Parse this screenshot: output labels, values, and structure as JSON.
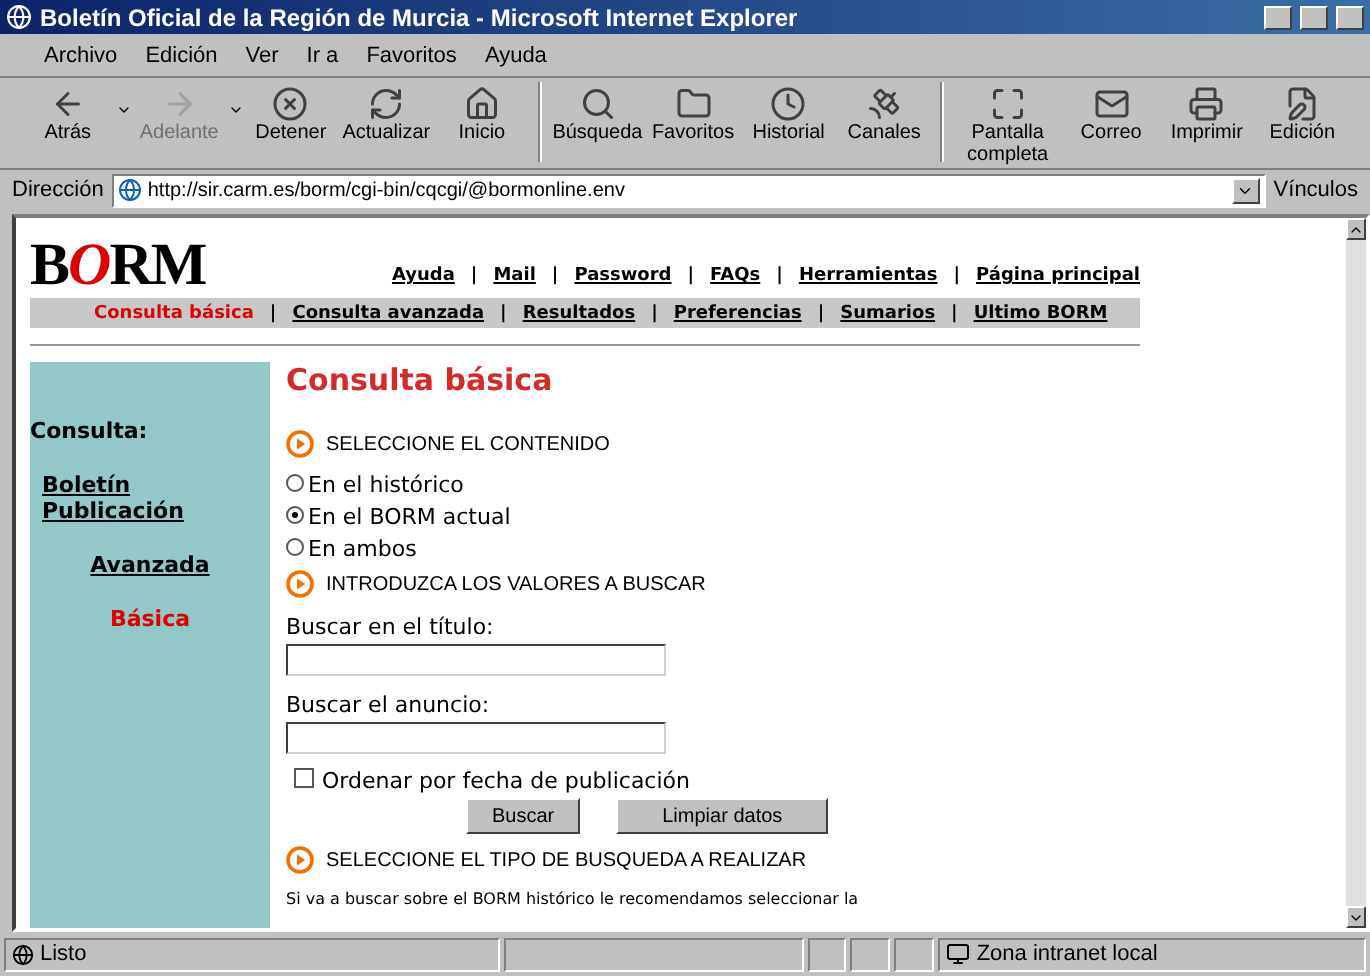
{
  "window": {
    "title": "Boletín Oficial de la Región de Murcia - Microsoft Internet Explorer"
  },
  "menu": [
    "Archivo",
    "Edición",
    "Ver",
    "Ir a",
    "Favoritos",
    "Ayuda"
  ],
  "toolbar": [
    {
      "kind": "back",
      "label": "Atrás",
      "disabled": false,
      "dropdown": true
    },
    {
      "kind": "forward",
      "label": "Adelante",
      "disabled": true,
      "dropdown": true
    },
    {
      "kind": "stop",
      "label": "Detener",
      "disabled": false,
      "dropdown": false
    },
    {
      "kind": "refresh",
      "label": "Actualizar",
      "disabled": false,
      "dropdown": false
    },
    {
      "kind": "home",
      "label": "Inicio",
      "disabled": false,
      "dropdown": false,
      "group_end": true
    },
    {
      "kind": "search",
      "label": "Búsqueda",
      "disabled": false,
      "dropdown": false
    },
    {
      "kind": "favorites",
      "label": "Favoritos",
      "disabled": false,
      "dropdown": false
    },
    {
      "kind": "history",
      "label": "Historial",
      "disabled": false,
      "dropdown": false
    },
    {
      "kind": "channels",
      "label": "Canales",
      "disabled": false,
      "dropdown": false,
      "group_end": true
    },
    {
      "kind": "fullscreen",
      "label": "Pantalla completa",
      "disabled": false,
      "dropdown": false
    },
    {
      "kind": "mail",
      "label": "Correo",
      "disabled": false,
      "dropdown": false
    },
    {
      "kind": "print",
      "label": "Imprimir",
      "disabled": false,
      "dropdown": false
    },
    {
      "kind": "edit",
      "label": "Edición",
      "disabled": false,
      "dropdown": false
    }
  ],
  "address": {
    "label": "Dirección",
    "value": "http://sir.carm.es/borm/cgi-bin/cqcgi/@bormonline.env",
    "links_label": "Vínculos"
  },
  "page": {
    "logo": "BORM",
    "separator": "|",
    "top_links": [
      "Ayuda",
      "Mail",
      "Password",
      "FAQs",
      "Herramientas",
      "Página principal"
    ],
    "nav": [
      {
        "label": "Consulta básica",
        "selected": true
      },
      {
        "label": "Consulta avanzada",
        "selected": false
      },
      {
        "label": "Resultados",
        "selected": false
      },
      {
        "label": "Preferencias",
        "selected": false
      },
      {
        "label": "Sumarios",
        "selected": false
      },
      {
        "label": "Ultimo BORM",
        "selected": false
      }
    ],
    "sidebar": {
      "heading": "Consulta:",
      "items": [
        {
          "kind": "section",
          "label": "Boletín Publicación",
          "selected": false
        },
        {
          "kind": "option",
          "label": "Avanzada",
          "selected": false
        },
        {
          "kind": "option",
          "label": "Básica",
          "selected": true
        }
      ]
    },
    "title": "Consulta básica",
    "section_1": "SELECCIONE EL CONTENIDO",
    "radios": [
      {
        "label": "En el histórico",
        "selected": false
      },
      {
        "label": "En el BORM actual",
        "selected": true
      },
      {
        "label": "En ambos",
        "selected": false
      }
    ],
    "section_2": "INTRODUZCA LOS VALORES A BUSCAR",
    "fields": [
      {
        "label": "Buscar en el título:"
      },
      {
        "label": "Buscar el anuncio:"
      }
    ],
    "sort_checkbox": {
      "label": "Ordenar por fecha de publicación",
      "checked": false
    },
    "buttons": [
      "Buscar",
      "Limpiar datos"
    ],
    "section_3": "SELECCIONE EL TIPO DE BUSQUEDA A REALIZAR",
    "note": "Si va a buscar sobre el BORM histórico le recomendamos seleccionar la"
  },
  "status_bar": {
    "text": "Listo",
    "zone": "Zona intranet local"
  }
}
